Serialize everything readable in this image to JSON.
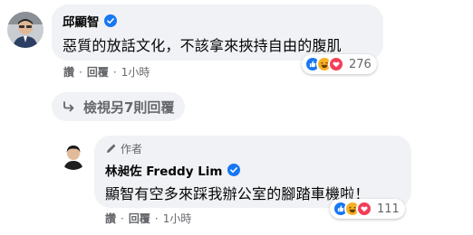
{
  "comment1": {
    "author": "邱顯智",
    "text": "惡質的放話文化，不該拿來挾持自由的腹肌",
    "reaction_icons": [
      "like-icon",
      "haha-icon",
      "love-icon"
    ],
    "reaction_count": "276",
    "actions": {
      "like": "讚",
      "reply": "回覆",
      "time": "1小時",
      "separator": "·"
    }
  },
  "view_replies": {
    "label": "檢視另7則回覆"
  },
  "reply1": {
    "badge_label": "作者",
    "author": "林昶佐 Freddy Lim",
    "text": "顯智有空多來踩我辦公室的腳踏車機啦！",
    "reaction_icons": [
      "like-icon",
      "haha-icon",
      "love-icon"
    ],
    "reaction_count": "111",
    "actions": {
      "like": "讚",
      "reply": "回覆",
      "time": "1小時",
      "separator": "·"
    }
  },
  "colors": {
    "bubble": "#f0f2f5",
    "verified": "#1877f2",
    "secondary_text": "#65676b",
    "like": "#1877f2",
    "haha": "#f7b125",
    "love": "#f33e58"
  }
}
